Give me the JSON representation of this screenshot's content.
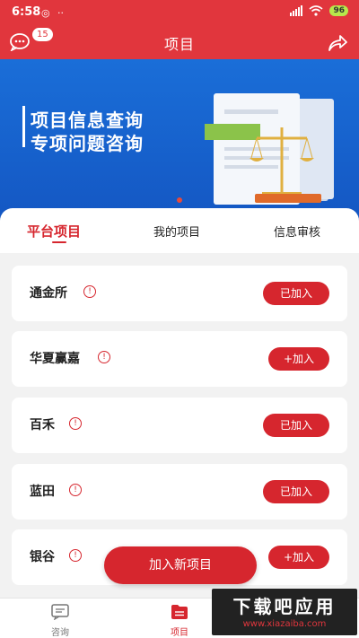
{
  "status_bar": {
    "time": "6:58",
    "battery": "96"
  },
  "header": {
    "title": "项目",
    "message_badge": "15"
  },
  "banner": {
    "line1": "项目信息查询",
    "line2": "专项问题咨询"
  },
  "tabs": [
    {
      "label": "平台项目",
      "active": true
    },
    {
      "label": "我的项目",
      "active": false
    },
    {
      "label": "信息审核",
      "active": false
    }
  ],
  "projects": [
    {
      "name": "通金所",
      "info": "!",
      "action": "已加入"
    },
    {
      "name": "华夏赢嘉",
      "info": "!",
      "action": "+加入"
    },
    {
      "name": "百禾",
      "info": "!",
      "action": "已加入"
    },
    {
      "name": "蓝田",
      "info": "!",
      "action": "已加入"
    },
    {
      "name": "银谷",
      "info": "!",
      "action": "+加入"
    }
  ],
  "fab_label": "加入新项目",
  "bottom_nav": [
    {
      "label": "咨询",
      "icon": "chat-icon"
    },
    {
      "label": "项目",
      "icon": "project-icon",
      "active": true
    }
  ],
  "watermark": {
    "line1": "下载吧应用",
    "line2": "www.xiazaiba.com"
  },
  "colors": {
    "brand_red": "#e1363d",
    "button_red": "#d6262e",
    "banner_blue": "#1a6ed8"
  }
}
